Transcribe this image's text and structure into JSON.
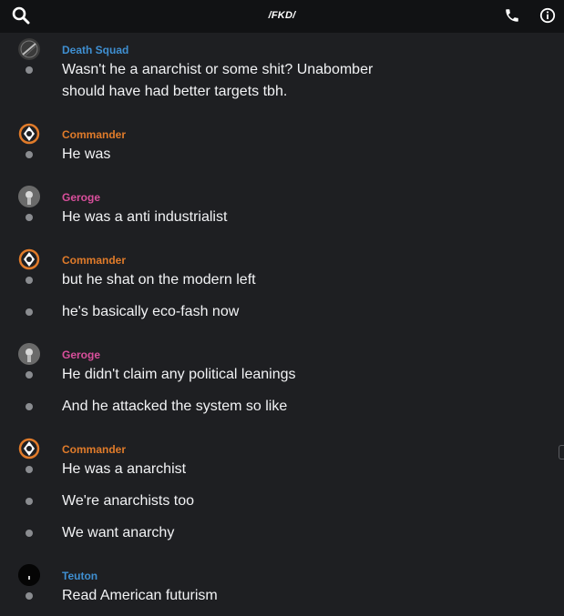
{
  "header": {
    "title": "/FKD/",
    "search_icon": "search-icon",
    "call_icon": "phone-icon",
    "info_icon": "info-icon"
  },
  "colors": {
    "background": "#1e1f22",
    "header_bg": "#111214",
    "message_text": "#f2f3f5",
    "bullet": "#8a8c90",
    "user_deathsquad": "#3f8fd1",
    "user_commander": "#e07b2a",
    "user_geroge": "#d94f9c",
    "user_teuton": "#3f8fd1"
  },
  "messages": [
    {
      "user": "Death Squad",
      "lines": [
        "Wasn't he a anarchist or some shit? Unabomber should have had better targets tbh."
      ]
    },
    {
      "user": "Commander",
      "lines": [
        "He was"
      ]
    },
    {
      "user": "Geroge",
      "lines": [
        "He was a anti industrialist"
      ]
    },
    {
      "user": "Commander",
      "lines": [
        "but he shat on the modern left",
        "he's basically eco-fash now"
      ]
    },
    {
      "user": "Geroge",
      "lines": [
        "He didn't claim any political leanings",
        "And he attacked the system so like"
      ]
    },
    {
      "user": "Commander",
      "lines": [
        "He was a anarchist",
        "We're anarchists too",
        "We want anarchy"
      ]
    },
    {
      "user": "Teuton",
      "lines": [
        "Read American futurism"
      ]
    }
  ]
}
